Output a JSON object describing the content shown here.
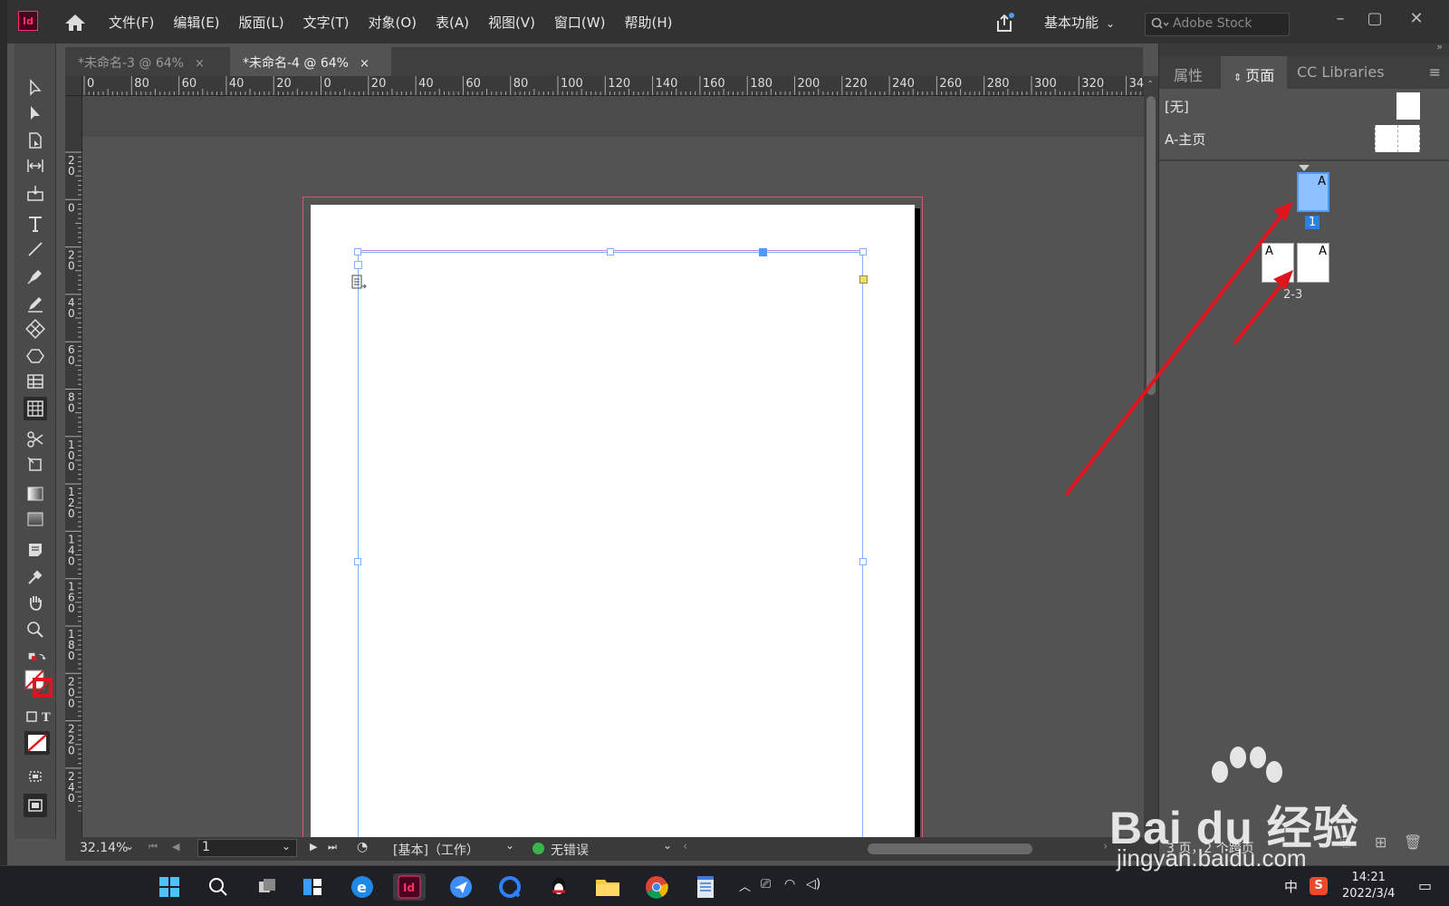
{
  "app": {
    "logo": "Id"
  },
  "menu": [
    "文件(F)",
    "编辑(E)",
    "版面(L)",
    "文字(T)",
    "对象(O)",
    "表(A)",
    "视图(V)",
    "窗口(W)",
    "帮助(H)"
  ],
  "workspace": "基本功能",
  "stock_placeholder": "Adobe Stock",
  "tabs": [
    {
      "title": "*未命名-3 @ 64%",
      "close": "×"
    },
    {
      "title": "*未命名-4 @ 64%",
      "close": "×"
    }
  ],
  "ruler_h": [
    "0",
    "80",
    "60",
    "40",
    "20",
    "0",
    "20",
    "40",
    "60",
    "80",
    "100",
    "120",
    "140",
    "160",
    "180",
    "200",
    "220",
    "240",
    "260",
    "280",
    "300",
    "320",
    "34"
  ],
  "ruler_v": [
    "2\n0",
    "0",
    "2\n0",
    "4\n0",
    "6\n0",
    "8\n0",
    "1\n0\n0",
    "1\n2\n0",
    "1\n4\n0",
    "1\n6\n0",
    "1\n8\n0",
    "2\n0\n0",
    "2\n2\n0",
    "2\n4\n0"
  ],
  "status": {
    "zoom": "32.14%",
    "page": "1",
    "style": "[基本]（工作）",
    "preflight": "无错误"
  },
  "panel": {
    "tabs": [
      "属性",
      "页面",
      "CC Libraries"
    ],
    "masters": [
      "[无]",
      "A-主页"
    ],
    "pages": {
      "page1": "1",
      "spread": "2-3",
      "master_letter": "A"
    },
    "summary": "3 页，2 个跨页"
  },
  "clock": {
    "time": "14:21",
    "date": "2022/3/4"
  },
  "tray": {
    "ime": "中"
  },
  "watermark": {
    "brand": "Bai du 经验",
    "url": "jingyan.baidu.com"
  },
  "colors": {
    "accent_red": "#e0141e",
    "selection_blue": "#4c9bff",
    "frame_blue": "#7fb2ff"
  }
}
